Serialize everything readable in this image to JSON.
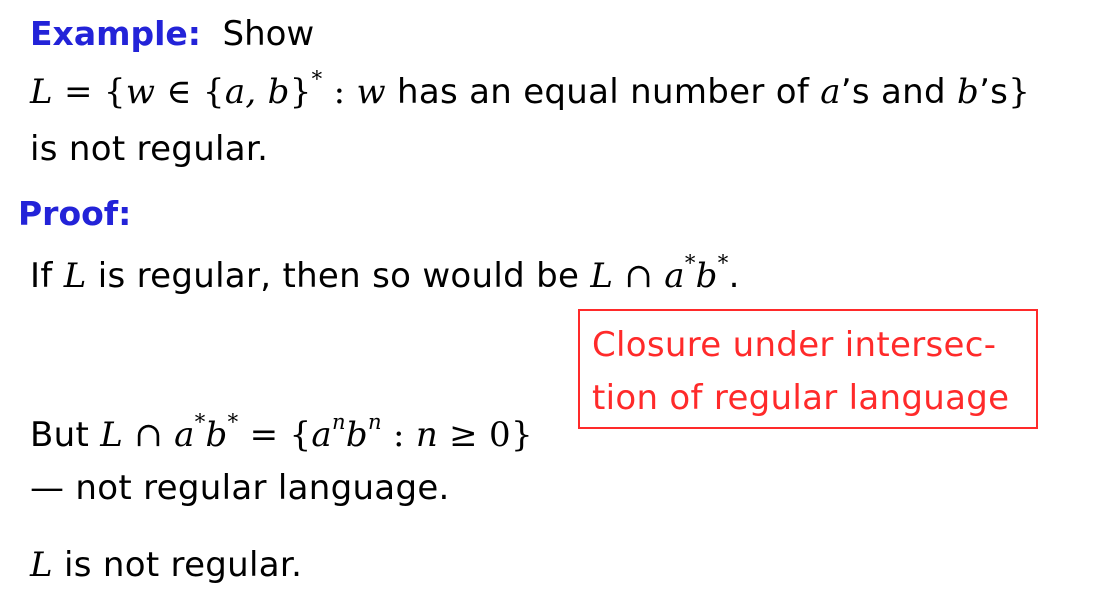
{
  "colors": {
    "heading": "#2323d8",
    "callout": "#ff2a2a",
    "text": "#000000",
    "background": "#ffffff"
  },
  "example": {
    "heading": "Example:",
    "intro": "Show",
    "lang_L": "L",
    "eq": " = {",
    "w1": "w",
    "in": " ∈ {",
    "ab": "a, b",
    "close_star": "}",
    "star": "*",
    "colon": " : ",
    "w2": "w",
    "text_has": " has an equal number of ",
    "a": "a",
    "text_s_and": "’s and ",
    "b": "b",
    "text_s": "’s",
    "final_brace": "}",
    "line3": "is not regular."
  },
  "proof": {
    "heading": "Proof:",
    "if": "If ",
    "L": "L",
    "mid": " is regular, then so would be ",
    "expr_L": "L",
    "cap": " ∩ ",
    "a": "a",
    "star1": "*",
    "b": "b",
    "star2": "*",
    "period": "."
  },
  "callout": {
    "line1": "Closure under intersec-",
    "line2": "tion of regular language"
  },
  "but": {
    "but": "But ",
    "L": "L",
    "cap": " ∩ ",
    "a": "a",
    "star1": "*",
    "b": "b",
    "star2": "*",
    "eq": " = {",
    "a2": "a",
    "n1": "n",
    "b2": "b",
    "n2": "n",
    "colon": " : ",
    "n3": "n",
    "geq": " ≥ 0}",
    "line2": "— not regular language."
  },
  "conclusion": {
    "L": "L",
    "text": " is not regular."
  }
}
